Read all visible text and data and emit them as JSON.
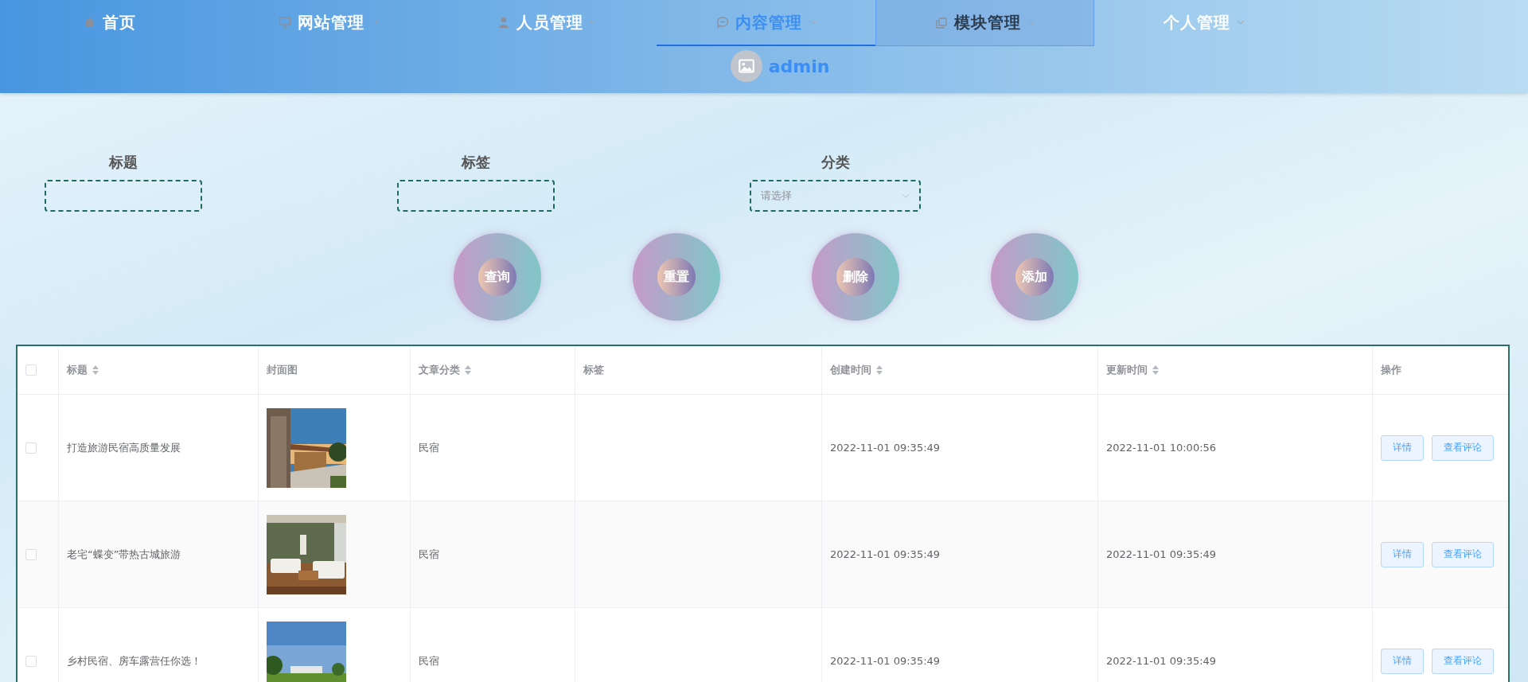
{
  "nav": {
    "items": [
      {
        "label": "首页",
        "dropdown": false,
        "selected": false,
        "hovered": false
      },
      {
        "label": "网站管理",
        "dropdown": true,
        "selected": false,
        "hovered": false
      },
      {
        "label": "人员管理",
        "dropdown": true,
        "selected": false,
        "hovered": false
      },
      {
        "label": "内容管理",
        "dropdown": true,
        "selected": true,
        "hovered": false
      },
      {
        "label": "模块管理",
        "dropdown": true,
        "selected": false,
        "hovered": true
      },
      {
        "label": "个人管理",
        "dropdown": true,
        "selected": false,
        "hovered": false
      }
    ],
    "user": {
      "name": "admin"
    }
  },
  "filters": [
    {
      "label": "标题",
      "kind": "input"
    },
    {
      "label": "标签",
      "kind": "input"
    },
    {
      "label": "分类",
      "kind": "select",
      "placeholder": "请选择"
    }
  ],
  "buttons": [
    "查询",
    "重置",
    "删除",
    "添加"
  ],
  "table": {
    "columns": [
      {
        "kind": "checkbox",
        "checked": false
      },
      {
        "label": "标题",
        "sortable": true
      },
      {
        "label": "封面图",
        "sortable": false
      },
      {
        "label": "文章分类",
        "sortable": true
      },
      {
        "label": "标签",
        "sortable": false
      },
      {
        "label": "创建时间",
        "sortable": true
      },
      {
        "label": "更新时间",
        "sortable": true
      },
      {
        "label": "操作",
        "sortable": false
      }
    ],
    "rows": [
      {
        "checked": false,
        "title": "打造旅游民宿高质量发展",
        "cover": {
          "kind": "picture"
        },
        "category": "民宿",
        "created": "2022-11-01 09:35:49",
        "updated": "2022-11-01 10:00:56",
        "actions": [
          "详情",
          "查看评论"
        ]
      },
      {
        "checked": false,
        "title": "老宅“蝶变”带热古城旅游",
        "cover": {
          "kind": "picture"
        },
        "category": "民宿",
        "created": "2022-11-01 09:35:49",
        "updated": "2022-11-01 09:35:49",
        "actions": [
          "详情",
          "查看评论"
        ]
      },
      {
        "checked": false,
        "title": "乡村民宿、房车露营任你选！",
        "cover": {
          "kind": "picture"
        },
        "category": "民宿",
        "created": "2022-11-01 09:35:49",
        "updated": "2022-11-01 09:35:49",
        "actions": [
          "详情",
          "查看评论"
        ]
      }
    ]
  }
}
